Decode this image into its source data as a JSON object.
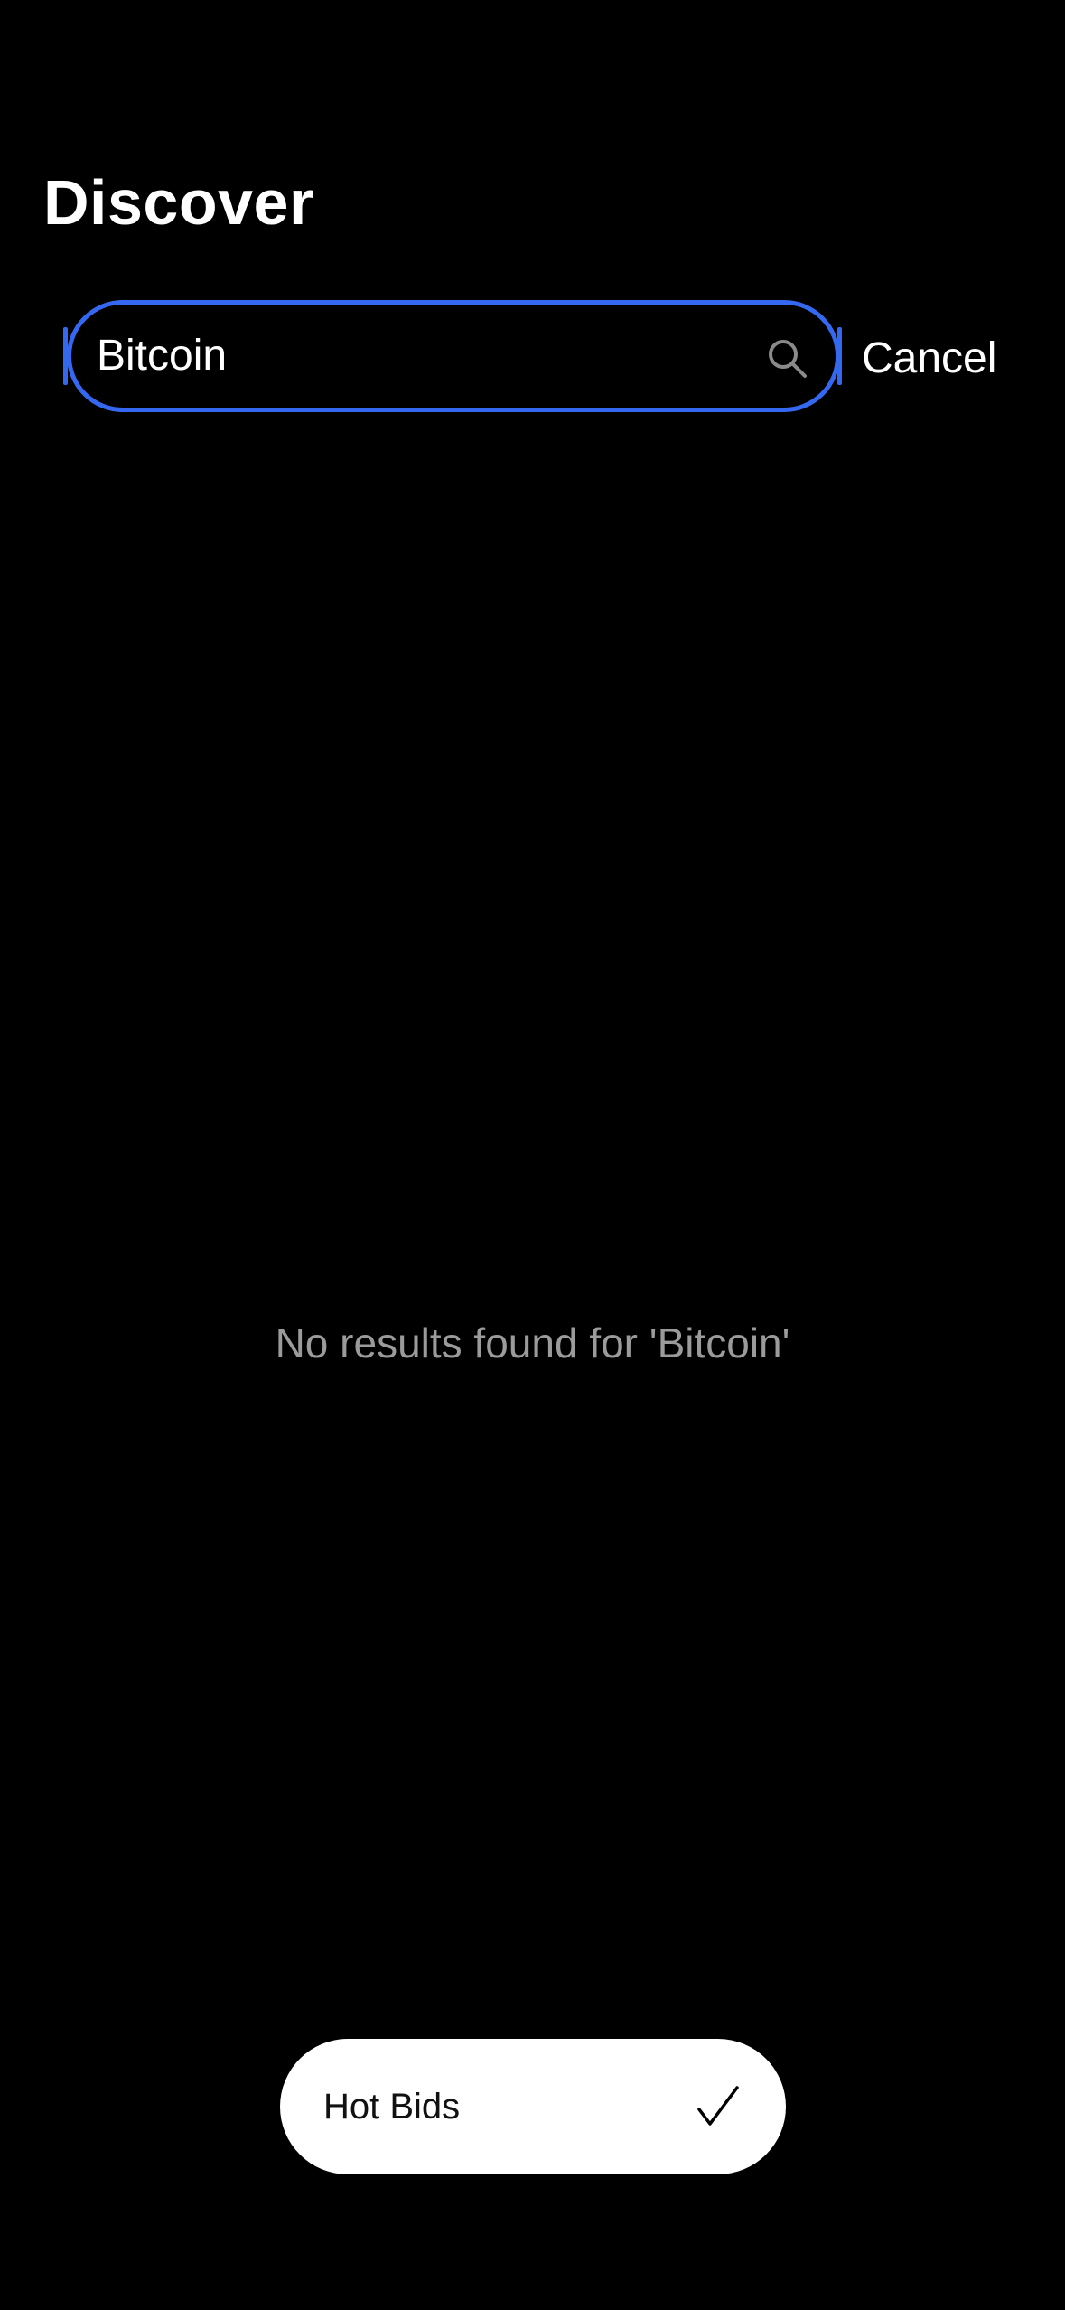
{
  "header": {
    "title": "Discover"
  },
  "search": {
    "value": "Bitcoin",
    "icon": "search-icon",
    "cancel_label": "Cancel",
    "accent_color": "#3568f0"
  },
  "results": {
    "empty_message": "No results found for 'Bitcoin'"
  },
  "filter": {
    "label": "Hot Bids",
    "selected": true,
    "icon": "check-icon"
  }
}
